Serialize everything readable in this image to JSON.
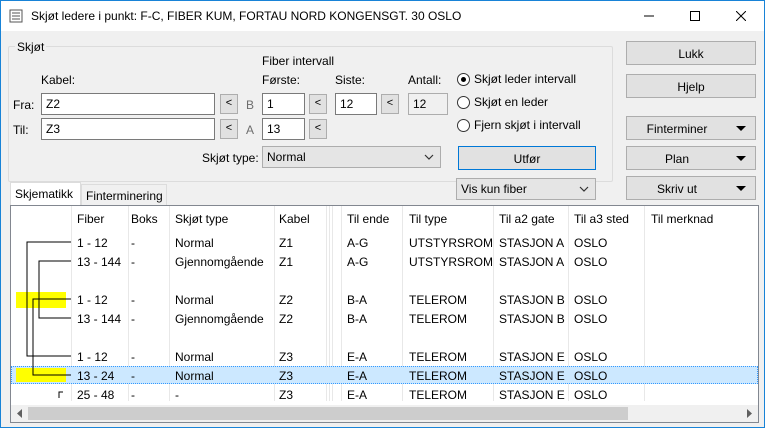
{
  "window": {
    "title": "Skjøt ledere i punkt: F-C, FIBER KUM, FORTAU NORD KONGENSGT. 30 OSLO"
  },
  "group": {
    "title": "Skjøt",
    "kabel_label": "Kabel:",
    "fiber_interval_label": "Fiber intervall",
    "forste_label": "Første:",
    "siste_label": "Siste:",
    "antall_label": "Antall:",
    "fra_label": "Fra:",
    "til_label": "Til:",
    "fra_kabel": "Z2",
    "til_kabel": "Z3",
    "fra_letter": "B",
    "til_letter": "A",
    "fra_forste": "1",
    "fra_siste": "12",
    "antall": "12",
    "til_forste": "13",
    "arrow": "<",
    "skjot_type_label": "Skjøt type:",
    "skjot_type_value": "Normal",
    "radio1": "Skjøt leder intervall",
    "radio2": "Skjøt en leder",
    "radio3": "Fjern skjøt i intervall",
    "utfor": "Utfør",
    "filter_value": "Vis kun fiber"
  },
  "buttons": {
    "lukk": "Lukk",
    "hjelp": "Hjelp",
    "finterminer": "Finterminer",
    "plan": "Plan",
    "skriv_ut": "Skriv ut"
  },
  "tabs": [
    "Skjematikk",
    "Finterminering"
  ],
  "table": {
    "columns": [
      "Fiber",
      "Boks",
      "Skjøt type",
      "Kabel",
      "Til ende",
      "Til type",
      "Til a2 gate",
      "Til a3 sted",
      "Til merknad"
    ],
    "rows": [
      [
        "1 - 12",
        "-",
        "Normal",
        "Z1",
        "A-G",
        "UTSTYRSROM",
        "STASJON A",
        "OSLO",
        ""
      ],
      [
        "13 - 144",
        "-",
        "Gjennomgående",
        "Z1",
        "A-G",
        "UTSTYRSROM",
        "STASJON A",
        "OSLO",
        ""
      ],
      [
        "1 - 12",
        "-",
        "Normal",
        "Z2",
        "B-A",
        "TELEROM",
        "STASJON B",
        "OSLO",
        ""
      ],
      [
        "13 - 144",
        "-",
        "Gjennomgående",
        "Z2",
        "B-A",
        "TELEROM",
        "STASJON B",
        "OSLO",
        ""
      ],
      [
        "1 - 12",
        "-",
        "Normal",
        "Z3",
        "E-A",
        "TELEROM",
        "STASJON E",
        "OSLO",
        ""
      ],
      [
        "13 - 24",
        "-",
        "Normal",
        "Z3",
        "E-A",
        "TELEROM",
        "STASJON E",
        "OSLO",
        ""
      ],
      [
        "25 - 48",
        "-",
        "-",
        "Z3",
        "E-A",
        "TELEROM",
        "STASJON E",
        "OSLO",
        ""
      ]
    ],
    "selected_row": 5,
    "highlight_color": "#ffff00",
    "selection_color": "#cce8ff"
  }
}
